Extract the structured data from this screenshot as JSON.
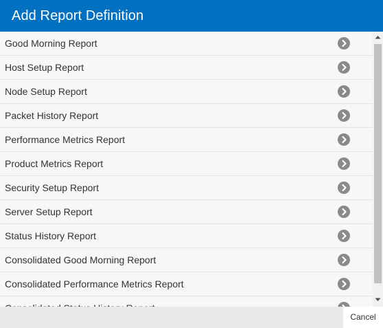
{
  "dialog": {
    "title": "Add Report Definition",
    "colors": {
      "header_bg": "#0070c0",
      "header_text": "#ffffff",
      "row_bg": "#f7f7f7",
      "icon_bg": "#8a8a8a"
    },
    "rows": [
      {
        "label": "Good Morning Report",
        "icon": "chevron-right-circle-icon"
      },
      {
        "label": "Host Setup Report",
        "icon": "chevron-right-circle-icon"
      },
      {
        "label": "Node Setup Report",
        "icon": "chevron-right-circle-icon"
      },
      {
        "label": "Packet History Report",
        "icon": "chevron-right-circle-icon"
      },
      {
        "label": "Performance Metrics Report",
        "icon": "chevron-right-circle-icon"
      },
      {
        "label": "Product Metrics Report",
        "icon": "chevron-right-circle-icon"
      },
      {
        "label": "Security Setup Report",
        "icon": "chevron-right-circle-icon"
      },
      {
        "label": "Server Setup Report",
        "icon": "chevron-right-circle-icon"
      },
      {
        "label": "Status History Report",
        "icon": "chevron-right-circle-icon"
      },
      {
        "label": "Consolidated Good Morning Report",
        "icon": "chevron-right-circle-icon"
      },
      {
        "label": "Consolidated Performance Metrics Report",
        "icon": "chevron-right-circle-icon"
      },
      {
        "label": "Consolidated Status History Report",
        "icon": "chevron-right-circle-icon"
      }
    ],
    "cancel_label": "Cancel"
  }
}
